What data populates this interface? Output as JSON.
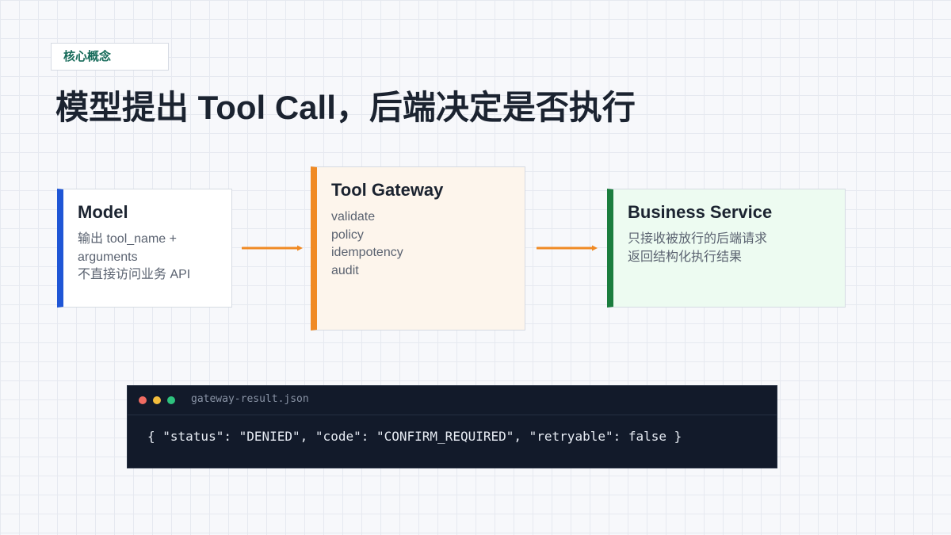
{
  "tag": "核心概念",
  "title": "模型提出 Tool Call，后端决定是否执行",
  "colors": {
    "model_accent": "#1f56d6",
    "gateway_accent": "#f08a24",
    "business_accent": "#1b7d3e",
    "arrow": "#f08a24"
  },
  "cards": {
    "model": {
      "title": "Model",
      "lines": [
        "输出 tool_name +",
        "arguments",
        "不直接访问业务 API"
      ]
    },
    "gateway": {
      "title": "Tool Gateway",
      "lines": [
        "validate",
        "policy",
        "idempotency",
        "audit"
      ]
    },
    "business": {
      "title": "Business Service",
      "lines": [
        "只接收被放行的后端请求",
        "返回结构化执行结果"
      ]
    }
  },
  "code_window": {
    "file_name": "gateway-result.json",
    "content": "{ \"status\": \"DENIED\", \"code\": \"CONFIRM_REQUIRED\", \"retryable\": false }"
  }
}
